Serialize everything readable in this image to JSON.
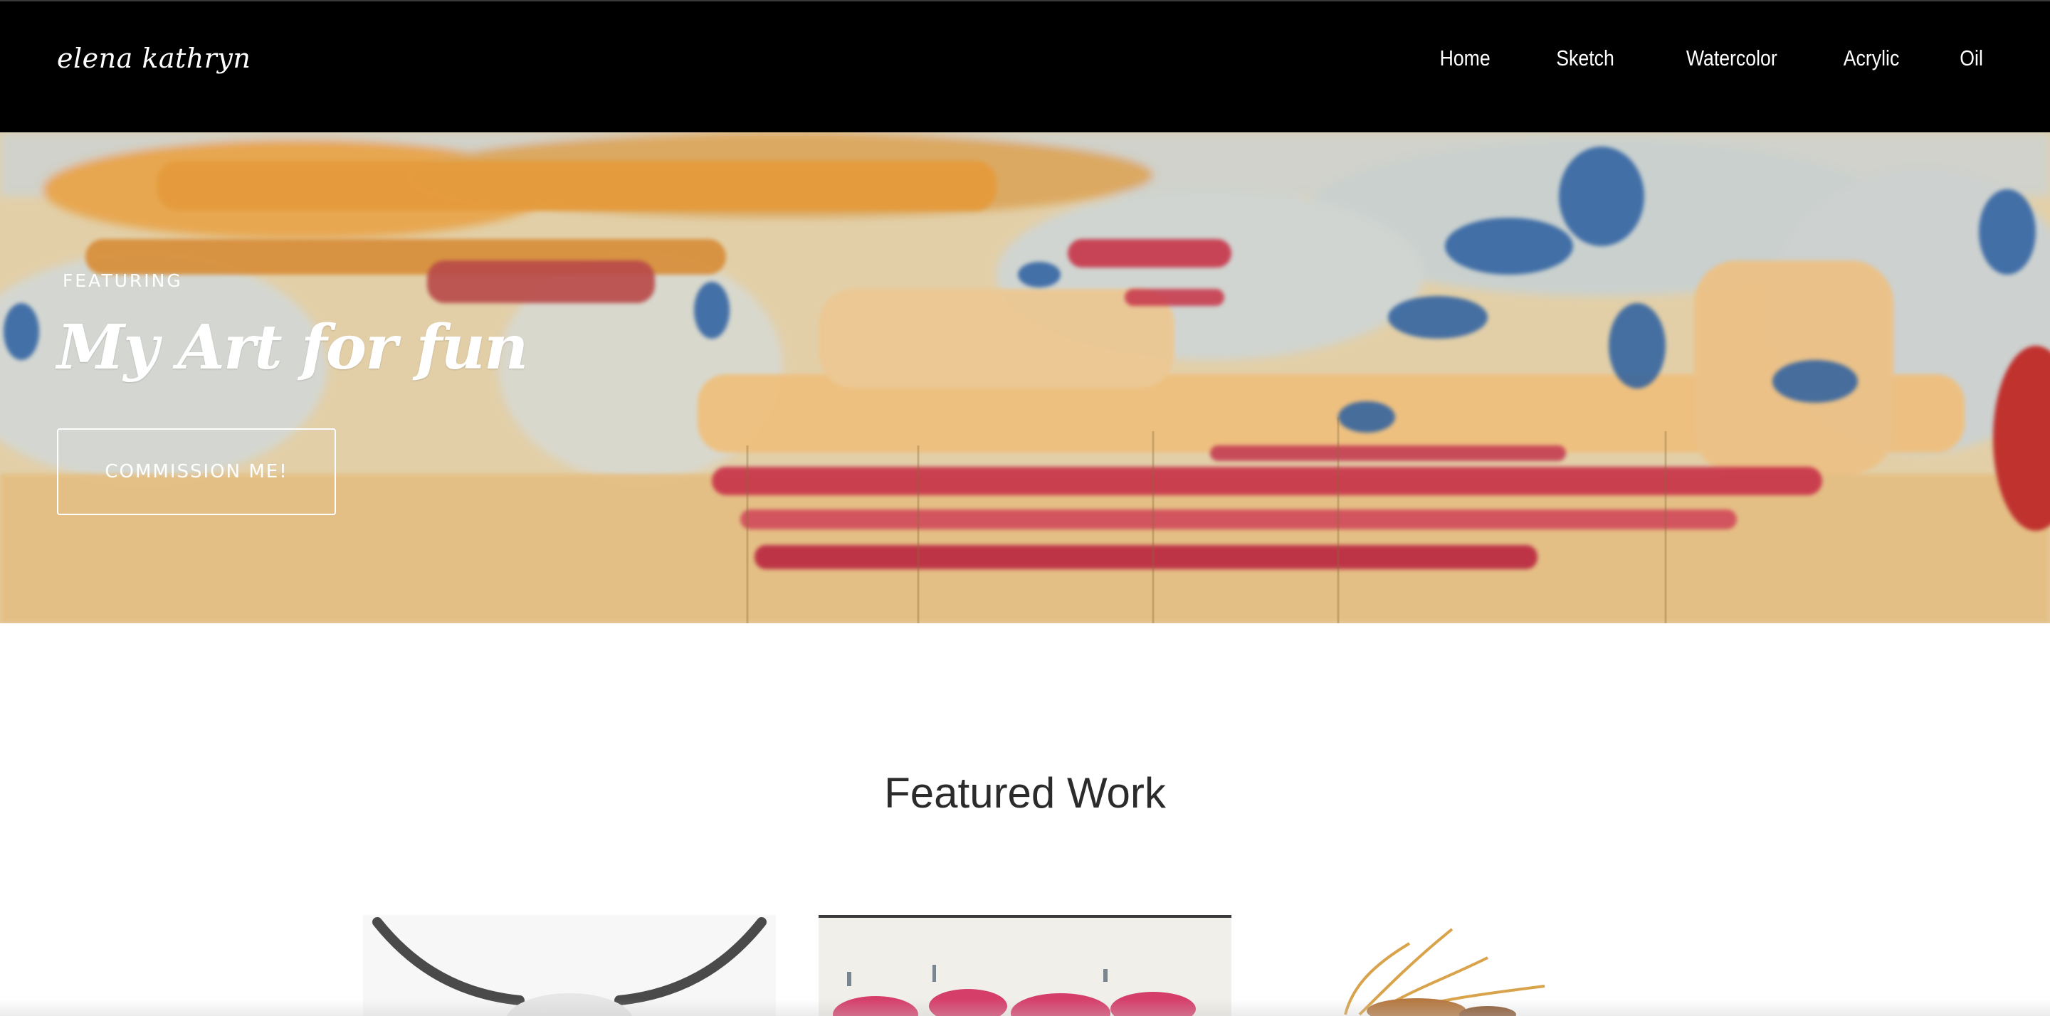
{
  "header": {
    "logo": "elena kathryn",
    "nav": [
      {
        "label": "Home"
      },
      {
        "label": "Sketch"
      },
      {
        "label": "Watercolor"
      },
      {
        "label": "Acrylic"
      },
      {
        "label": "Oil"
      }
    ]
  },
  "hero": {
    "eyebrow": "FEATURING",
    "title": "My Art for fun",
    "cta_label": "COMMISSION ME!",
    "image": "abstract-acrylic-painting"
  },
  "featured": {
    "title": "Featured Work",
    "items": [
      {
        "image": "bull-horns-sketch"
      },
      {
        "image": "pink-roses-painting"
      },
      {
        "image": "dried-flowers-painting"
      }
    ]
  },
  "colors": {
    "header_bg": "#000000",
    "text_light": "#ffffff",
    "heading_dark": "#2b2b2b",
    "page_bg": "#ffffff"
  }
}
